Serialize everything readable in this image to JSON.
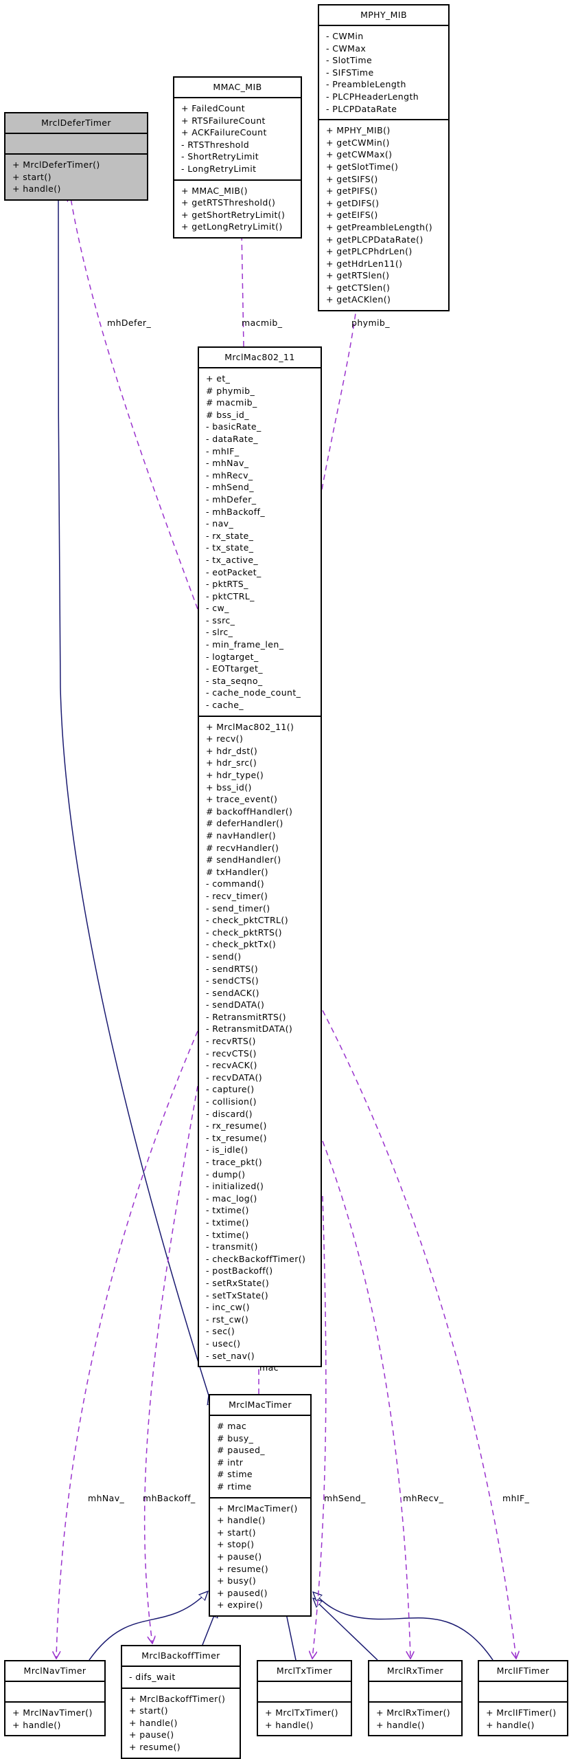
{
  "colors": {
    "inheritance": "#191970",
    "usage": "#9a32cd",
    "highlight": "#bfbfbf"
  },
  "classes": [
    {
      "id": "MrclDeferTimer",
      "name": "MrclDeferTimer",
      "highlighted": true,
      "attributes": [],
      "methods": [
        "+ MrclDeferTimer()",
        "+ start()",
        "+ handle()"
      ]
    },
    {
      "id": "MMAC_MIB",
      "name": "MMAC_MIB",
      "highlighted": false,
      "attributes": [
        "+ FailedCount",
        "+ RTSFailureCount",
        "+ ACKFailureCount",
        "- RTSThreshold",
        "- ShortRetryLimit",
        "- LongRetryLimit"
      ],
      "methods": [
        "+ MMAC_MIB()",
        "+ getRTSThreshold()",
        "+ getShortRetryLimit()",
        "+ getLongRetryLimit()"
      ]
    },
    {
      "id": "MPHY_MIB",
      "name": "MPHY_MIB",
      "highlighted": false,
      "attributes": [
        "- CWMin",
        "- CWMax",
        "- SlotTime",
        "- SIFSTime",
        "- PreambleLength",
        "- PLCPHeaderLength",
        "- PLCPDataRate"
      ],
      "methods": [
        "+ MPHY_MIB()",
        "+ getCWMin()",
        "+ getCWMax()",
        "+ getSlotTime()",
        "+ getSIFS()",
        "+ getPIFS()",
        "+ getDIFS()",
        "+ getEIFS()",
        "+ getPreambleLength()",
        "+ getPLCPDataRate()",
        "+ getPLCPhdrLen()",
        "+ getHdrLen11()",
        "+ getRTSlen()",
        "+ getCTSlen()",
        "+ getACKlen()"
      ]
    },
    {
      "id": "MrclMac802_11",
      "name": "MrclMac802_11",
      "highlighted": false,
      "attributes": [
        "+ et_",
        "# phymib_",
        "# macmib_",
        "# bss_id_",
        "- basicRate_",
        "- dataRate_",
        "- mhIF_",
        "- mhNav_",
        "- mhRecv_",
        "- mhSend_",
        "- mhDefer_",
        "- mhBackoff_",
        "- nav_",
        "- rx_state_",
        "- tx_state_",
        "- tx_active_",
        "- eotPacket_",
        "- pktRTS_",
        "- pktCTRL_",
        "- cw_",
        "- ssrc_",
        "- slrc_",
        "- min_frame_len_",
        "- logtarget_",
        "- EOTtarget_",
        "- sta_seqno_",
        "- cache_node_count_",
        "- cache_"
      ],
      "methods": [
        "+ MrclMac802_11()",
        "+ recv()",
        "+ hdr_dst()",
        "+ hdr_src()",
        "+ hdr_type()",
        "+ bss_id()",
        "+ trace_event()",
        "# backoffHandler()",
        "# deferHandler()",
        "# navHandler()",
        "# recvHandler()",
        "# sendHandler()",
        "# txHandler()",
        "- command()",
        "- recv_timer()",
        "- send_timer()",
        "- check_pktCTRL()",
        "- check_pktRTS()",
        "- check_pktTx()",
        "- send()",
        "- sendRTS()",
        "- sendCTS()",
        "- sendACK()",
        "- sendDATA()",
        "- RetransmitRTS()",
        "- RetransmitDATA()",
        "- recvRTS()",
        "- recvCTS()",
        "- recvACK()",
        "- recvDATA()",
        "- capture()",
        "- collision()",
        "- discard()",
        "- rx_resume()",
        "- tx_resume()",
        "- is_idle()",
        "- trace_pkt()",
        "- dump()",
        "- initialized()",
        "- mac_log()",
        "- txtime()",
        "- txtime()",
        "- txtime()",
        "- transmit()",
        "- checkBackoffTimer()",
        "- postBackoff()",
        "- setRxState()",
        "- setTxState()",
        "- inc_cw()",
        "- rst_cw()",
        "- sec()",
        "- usec()",
        "- set_nav()"
      ]
    },
    {
      "id": "MrclMacTimer",
      "name": "MrclMacTimer",
      "highlighted": false,
      "attributes": [
        "# mac",
        "# busy_",
        "# paused_",
        "# intr",
        "# stime",
        "# rtime"
      ],
      "methods": [
        "+ MrclMacTimer()",
        "+ handle()",
        "+ start()",
        "+ stop()",
        "+ pause()",
        "+ resume()",
        "+ busy()",
        "+ paused()",
        "+ expire()"
      ]
    },
    {
      "id": "MrclNavTimer",
      "name": "MrclNavTimer",
      "highlighted": false,
      "attributes": [],
      "methods": [
        "+ MrclNavTimer()",
        "+ handle()"
      ]
    },
    {
      "id": "MrclBackoffTimer",
      "name": "MrclBackoffTimer",
      "highlighted": false,
      "attributes": [
        "- difs_wait"
      ],
      "methods": [
        "+ MrclBackoffTimer()",
        "+ start()",
        "+ handle()",
        "+ pause()",
        "+ resume()"
      ]
    },
    {
      "id": "MrclTxTimer",
      "name": "MrclTxTimer",
      "highlighted": false,
      "attributes": [],
      "methods": [
        "+ MrclTxTimer()",
        "+ handle()"
      ]
    },
    {
      "id": "MrclRxTimer",
      "name": "MrclRxTimer",
      "highlighted": false,
      "attributes": [],
      "methods": [
        "+ MrclRxTimer()",
        "+ handle()"
      ]
    },
    {
      "id": "MrclIFTimer",
      "name": "MrclIFTimer",
      "highlighted": false,
      "attributes": [],
      "methods": [
        "+ MrclIFTimer()",
        "+ handle()"
      ]
    }
  ],
  "edge_labels": {
    "mhDefer": "mhDefer_",
    "macmib": "macmib_",
    "phymib": "phymib_",
    "mac": "mac",
    "mhNav": "mhNav_",
    "mhBackoff": "mhBackoff_",
    "mhSend": "mhSend_",
    "mhRecv": "mhRecv_",
    "mhIF": "mhIF_"
  }
}
